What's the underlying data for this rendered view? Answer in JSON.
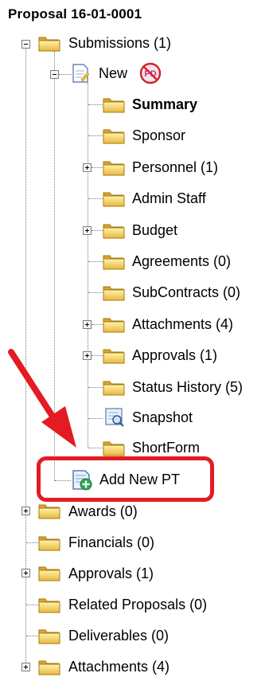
{
  "title": "Proposal 16-01-0001",
  "tree": {
    "submissions": "Submissions (1)",
    "new": "New",
    "pd_badge": "PD",
    "new_children": [
      "Summary",
      "Sponsor",
      "Personnel (1)",
      "Admin Staff",
      "Budget",
      "Agreements (0)",
      "SubContracts (0)",
      "Attachments (4)",
      "Approvals (1)",
      "Status History (5)",
      "Snapshot",
      "ShortForm"
    ],
    "add_new_pt": "Add New PT",
    "root_children": [
      "Awards (0)",
      "Financials (0)",
      "Approvals (1)",
      "Related Proposals (0)",
      "Deliverables (0)",
      "Attachments (4)"
    ]
  },
  "colors": {
    "highlight": "#e31b23",
    "folder": "#f2c94c"
  }
}
